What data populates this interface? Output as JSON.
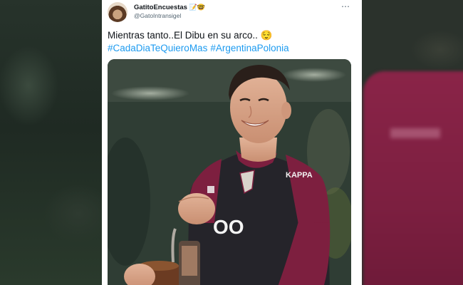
{
  "tweet": {
    "author_name": "GatitoEncuestas",
    "author_emojis": "📝🤓",
    "handle": "@GatoIntransigel",
    "more_icon": "⋯",
    "text": "Mientras tanto..El Dibu en su arco.. 😌",
    "hashtags": [
      "#CadaDiaTeQuieroMas",
      "#ArgentinaPolonia"
    ],
    "jersey_text": "OO"
  },
  "colors": {
    "link": "#1d9bf0",
    "text": "#0f1419",
    "secondary": "#536471",
    "jersey": "#7d1f3f"
  }
}
